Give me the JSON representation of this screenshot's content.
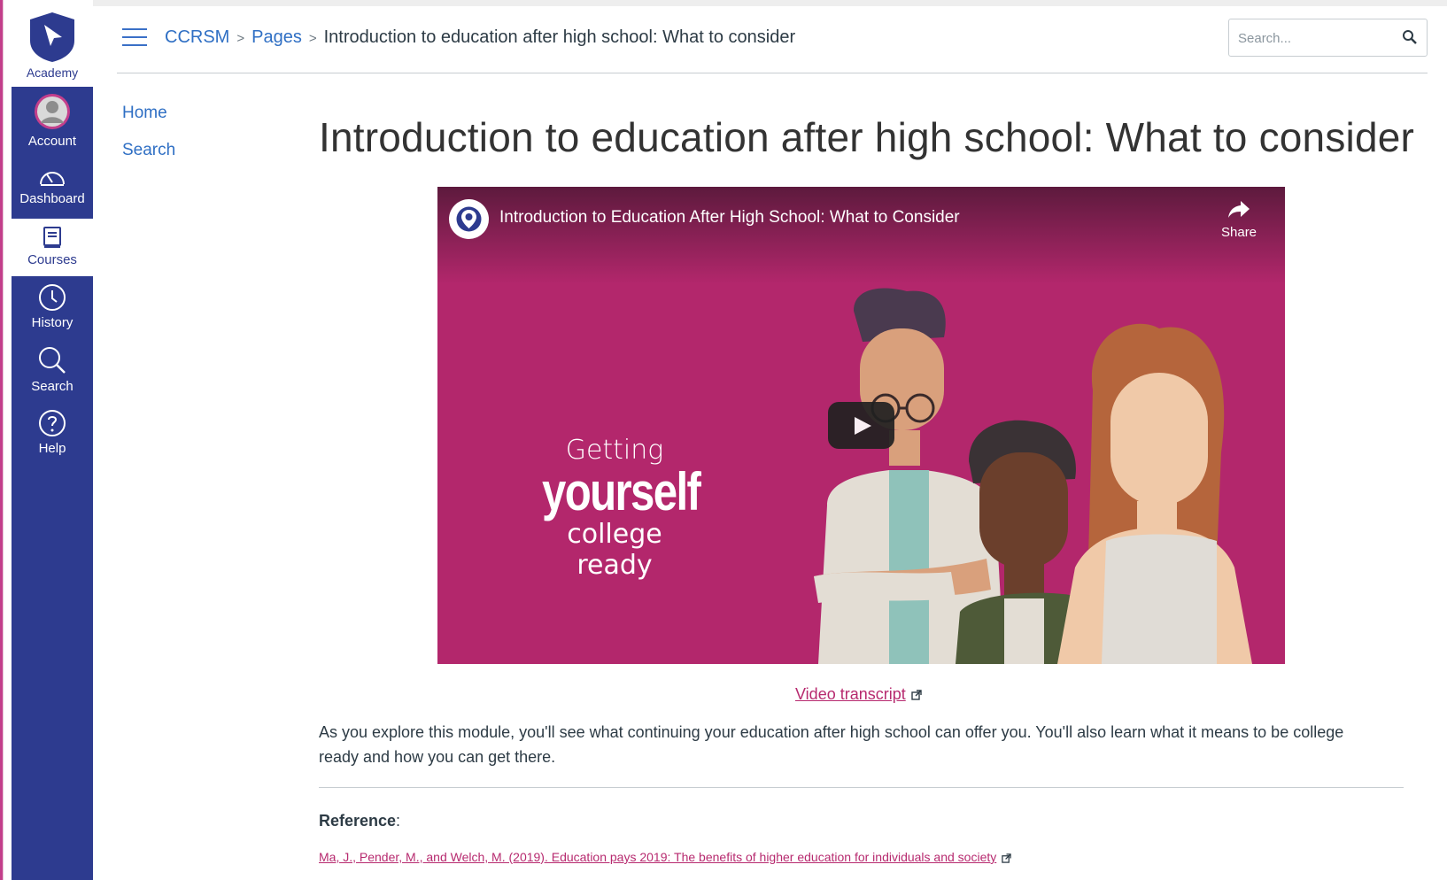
{
  "global_nav": {
    "logo_label": "Academy",
    "items": [
      {
        "label": "Account",
        "icon": "avatar-icon"
      },
      {
        "label": "Dashboard",
        "icon": "dashboard-icon"
      },
      {
        "label": "Courses",
        "icon": "courses-icon",
        "active": true
      },
      {
        "label": "History",
        "icon": "clock-icon"
      },
      {
        "label": "Search",
        "icon": "search-icon"
      },
      {
        "label": "Help",
        "icon": "help-icon"
      }
    ],
    "colors": {
      "nav_bg": "#2d3b8f",
      "active_bg": "#ffffff"
    }
  },
  "header": {
    "breadcrumbs": [
      "CCRSM",
      "Pages",
      "Introduction to education after high school: What to consider"
    ],
    "separator": ">",
    "search_placeholder": "Search..."
  },
  "course_nav": {
    "items": [
      "Home",
      "Search"
    ]
  },
  "content": {
    "title": "Introduction to education after high school: What to consider",
    "video": {
      "title": "Introduction to Education After High School: What to Consider",
      "share_label": "Share",
      "promo_line1": "Getting",
      "promo_line2": "yourself",
      "promo_line3": "college ready",
      "bg_color": "#b3276c"
    },
    "transcript_link": "Video transcript",
    "body": "As you explore this module, you'll see what continuing your education after high school can offer you. You'll also learn what it means to be college ready and how you can get there.",
    "reference_label": "Reference",
    "reference_colon": ":",
    "reference_link": "Ma, J., Pender, M., and Welch, M. (2019). Education pays 2019: The benefits of higher education for individuals and society",
    "link_color": "#b72a6f"
  }
}
